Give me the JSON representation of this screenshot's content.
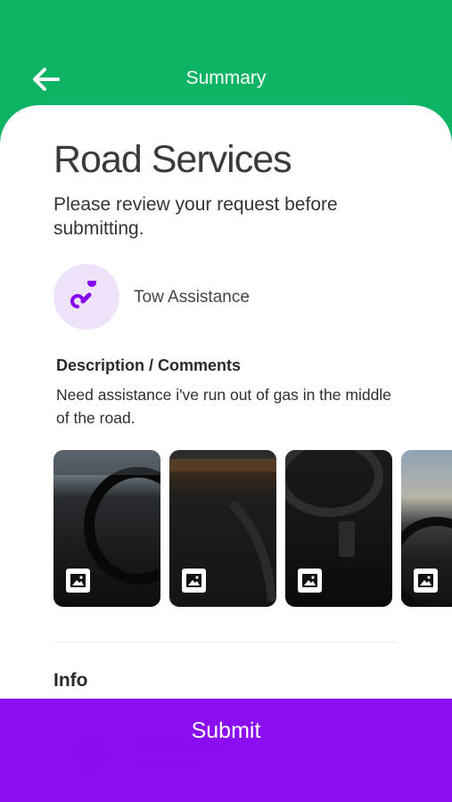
{
  "header": {
    "title": "Summary",
    "back_icon": "arrow-left-icon",
    "background": "#0db463"
  },
  "main": {
    "title": "Road Services",
    "subtitle": "Please review your request before submitting.",
    "service": {
      "name": "Tow Assistance",
      "icon": "tow-hook-icon",
      "accent": "#8604f3"
    },
    "description": {
      "title": "Description / Comments",
      "text": "Need assistance i've run out of gas in the middle of the road."
    },
    "photos": [
      {
        "icon": "image-icon"
      },
      {
        "icon": "image-icon"
      },
      {
        "icon": "image-icon"
      },
      {
        "icon": "image-icon"
      }
    ],
    "info": {
      "title": "Info"
    }
  },
  "footer": {
    "submit_label": "Submit",
    "background": "#8604f3"
  }
}
